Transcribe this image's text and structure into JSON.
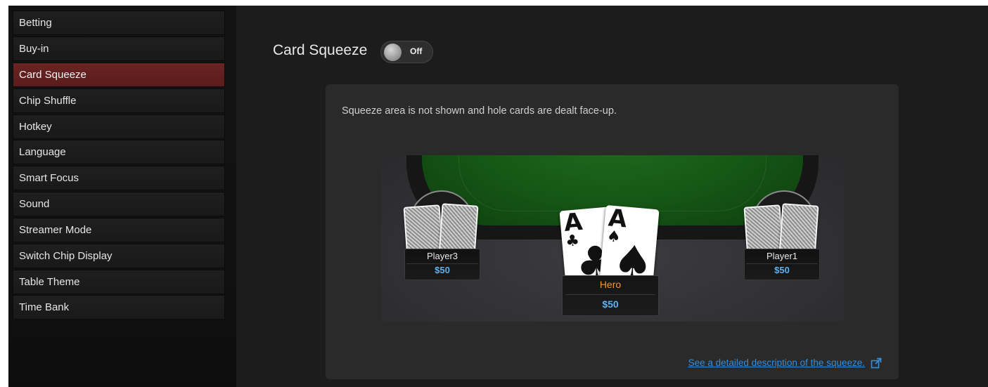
{
  "sidebar": {
    "items": [
      {
        "label": "Betting",
        "active": false
      },
      {
        "label": "Buy-in",
        "active": false
      },
      {
        "label": "Card Squeeze",
        "active": true
      },
      {
        "label": "Chip Shuffle",
        "active": false
      },
      {
        "label": "Hotkey",
        "active": false
      },
      {
        "label": "Language",
        "active": false
      },
      {
        "label": "Smart Focus",
        "active": false
      },
      {
        "label": "Sound",
        "active": false
      },
      {
        "label": "Streamer Mode",
        "active": false
      },
      {
        "label": "Switch Chip Display",
        "active": false
      },
      {
        "label": "Table Theme",
        "active": false
      },
      {
        "label": "Time Bank",
        "active": false
      }
    ]
  },
  "main": {
    "title": "Card Squeeze",
    "toggle": {
      "label": "Off",
      "state": "off"
    },
    "description": "Squeeze area is not shown and hole cards are dealt face-up.",
    "link_text": "See a detailed description of the squeeze.",
    "link_icon": "external-link-icon"
  },
  "table": {
    "players": [
      {
        "name": "Player3",
        "stack": "$50"
      },
      {
        "name": "Hero",
        "stack": "$50"
      },
      {
        "name": "Player1",
        "stack": "$50"
      }
    ],
    "hero_cards": [
      {
        "rank": "A",
        "suit": "♣"
      },
      {
        "rank": "A",
        "suit": "♠"
      }
    ]
  },
  "colors": {
    "active_menu": "#5a1c1c",
    "felt": "#155515",
    "hero_name": "#ef9a2e",
    "stack": "#5fb2ef",
    "link": "#2f8fe0"
  }
}
